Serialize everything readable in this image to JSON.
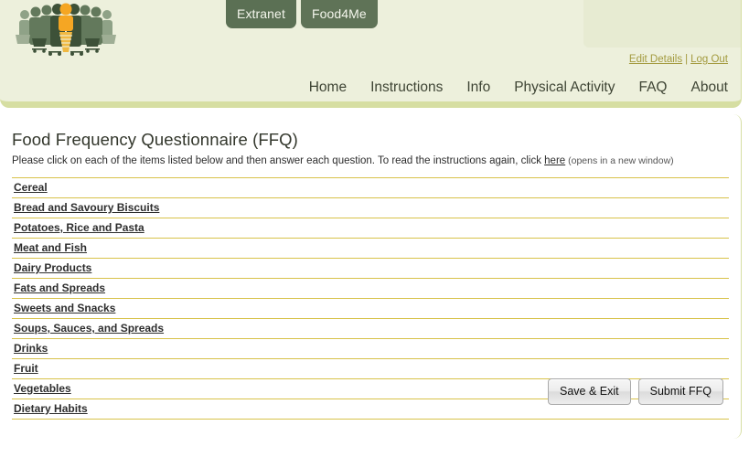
{
  "header": {
    "logo": {
      "name": "crowd-shopping-logo",
      "highlight_color": "#f5a623",
      "crowd_color": "#4e6349"
    },
    "tabs": [
      {
        "label": "Extranet",
        "name": "tab-extranet"
      },
      {
        "label": "Food4Me",
        "name": "tab-food4me"
      }
    ],
    "account_links": [
      {
        "label": "Edit Details",
        "name": "edit-details-link"
      },
      {
        "label": "Log Out",
        "name": "log-out-link"
      }
    ],
    "account_separator": "|",
    "nav": [
      {
        "label": "Home",
        "name": "nav-home"
      },
      {
        "label": "Instructions",
        "name": "nav-instructions"
      },
      {
        "label": "Info",
        "name": "nav-info"
      },
      {
        "label": "Physical Activity",
        "name": "nav-physical-activity"
      },
      {
        "label": "FAQ",
        "name": "nav-faq"
      },
      {
        "label": "About",
        "name": "nav-about"
      }
    ],
    "band_color": "#edf0dc",
    "band_border_color": "#d6dea2",
    "tab_color": "#5b7054",
    "link_color": "#a39a3e"
  },
  "main": {
    "title": "Food Frequency Questionnaire (FFQ)",
    "intro_part1": "Please click on each of the items listed below and then answer each question. To read the instructions again, click ",
    "intro_link": "here",
    "intro_note": " (opens in a new window)",
    "rule_color": "#d8c24a",
    "items": [
      "Cereal",
      "Bread and Savoury Biscuits",
      "Potatoes, Rice and Pasta",
      "Meat and Fish",
      "Dairy Products",
      "Fats and Spreads",
      "Sweets and Snacks",
      "Soups, Sauces, and Spreads",
      "Drinks",
      "Fruit",
      "Vegetables",
      "Dietary Habits"
    ],
    "buttons": [
      {
        "label": "Save & Exit",
        "name": "save-and-exit-button"
      },
      {
        "label": "Submit FFQ",
        "name": "submit-ffq-button"
      }
    ]
  }
}
